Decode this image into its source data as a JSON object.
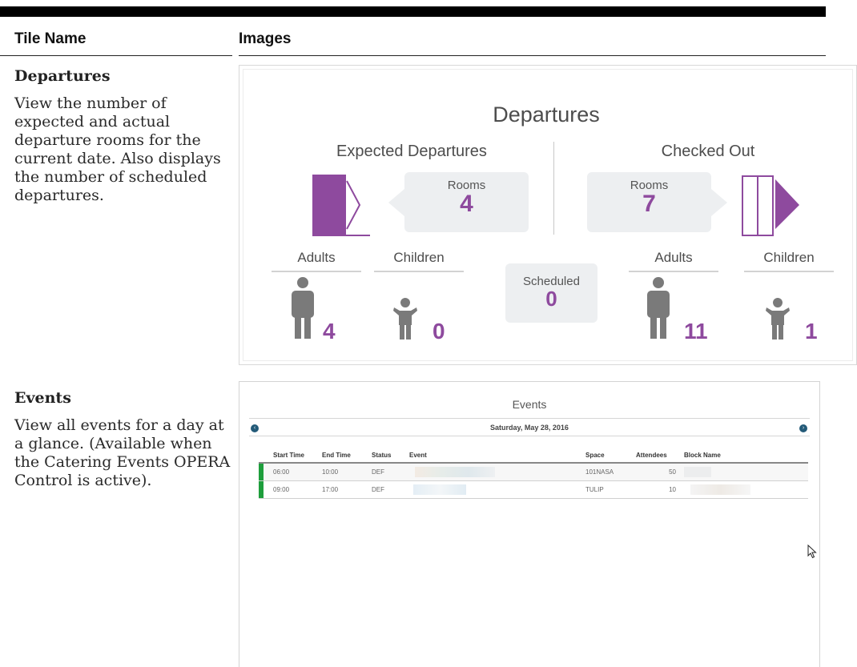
{
  "table": {
    "col_tile_name": "Tile Name",
    "col_images": "Images"
  },
  "rows": {
    "departures": {
      "name": "Departures",
      "description": "View the number of expected and actual departure rooms for the current date. Also displays the number of scheduled departures."
    },
    "events": {
      "name": "Events",
      "description": "View all events for a day at a glance. (Available when the Catering Events OPERA Control is active)."
    }
  },
  "departures_tile": {
    "title": "Departures",
    "expected": {
      "heading": "Expected Departures",
      "rooms_label": "Rooms",
      "rooms_value": "4",
      "adults_label": "Adults",
      "children_label": "Children",
      "adults_value": "4",
      "children_value": "0"
    },
    "checked_out": {
      "heading": "Checked Out",
      "rooms_label": "Rooms",
      "rooms_value": "7",
      "adults_label": "Adults",
      "children_label": "Children",
      "adults_value": "11",
      "children_value": "1"
    },
    "scheduled": {
      "label": "Scheduled",
      "value": "0"
    },
    "accent_color": "#8e4a9e"
  },
  "events_tile": {
    "title": "Events",
    "date": "Saturday, May 28, 2016",
    "prev_icon": "chevron-left-icon",
    "next_icon": "chevron-right-icon",
    "columns": [
      "Start Time",
      "End Time",
      "Status",
      "Event",
      "Space",
      "Attendees",
      "Block Name"
    ],
    "rows": [
      {
        "start": "06:00",
        "end": "10:00",
        "status": "DEF",
        "space": "101NASA",
        "attendees": "50"
      },
      {
        "start": "09:00",
        "end": "17:00",
        "status": "DEF",
        "space": "TULIP",
        "attendees": "10"
      }
    ],
    "status_bar_color": "#1e9e3c",
    "nav_button_color": "#235a78"
  }
}
